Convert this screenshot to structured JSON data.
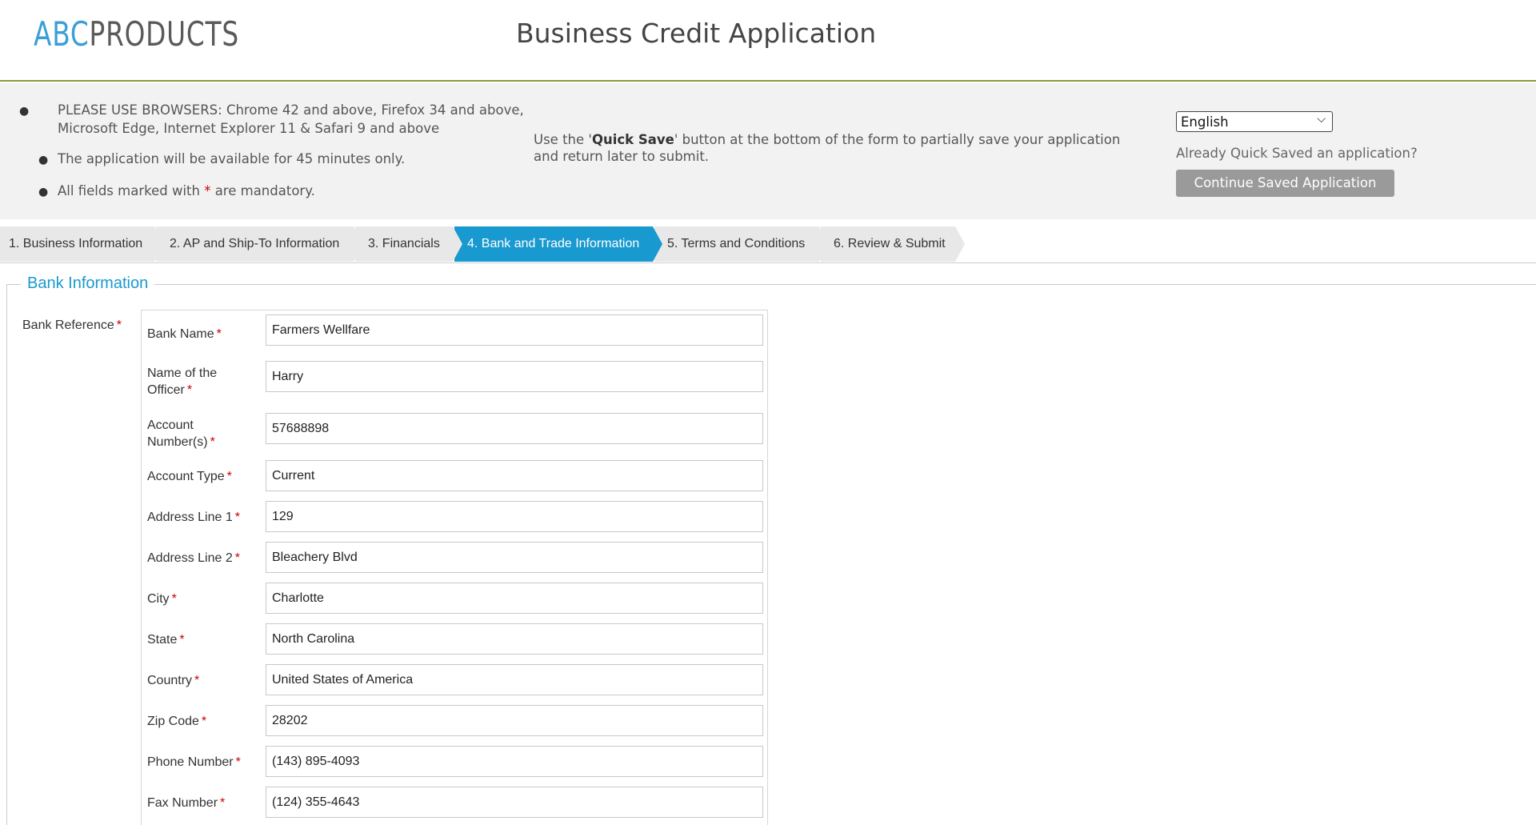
{
  "header": {
    "logo_abc": "ABC",
    "logo_products": "PRODUCTS",
    "title": "Business Credit Application"
  },
  "notice": {
    "items": [
      {
        "text": "PLEASE USE BROWSERS: Chrome 42 and above, Firefox 34 and above, Microsoft Edge, Internet Explorer 11 & Safari 9 and above"
      },
      {
        "text": "The application will be available for 45 minutes only."
      },
      {
        "text_before": "All fields marked with ",
        "asterisk": "*",
        "text_after": " are mandatory."
      }
    ],
    "quick_save_before": "Use the '",
    "quick_save_bold": "Quick Save",
    "quick_save_after": "' button at the bottom of the form to partially save your application and return later to submit.",
    "language": "English",
    "already_saved": "Already Quick Saved an application?",
    "continue_button": "Continue Saved Application"
  },
  "steps": [
    {
      "label": "1. Business Information",
      "active": false
    },
    {
      "label": "2. AP and Ship-To Information",
      "active": false
    },
    {
      "label": "3. Financials",
      "active": false
    },
    {
      "label": "4. Bank and Trade Information",
      "active": true
    },
    {
      "label": "5. Terms and Conditions",
      "active": false
    },
    {
      "label": "6. Review & Submit",
      "active": false
    }
  ],
  "section": {
    "legend": "Bank Information",
    "bank_reference_label": "Bank Reference",
    "required_mark": "*"
  },
  "fields": [
    {
      "label": "Bank Name",
      "value": "Farmers Wellfare"
    },
    {
      "label": "Name of the Officer",
      "value": "Harry"
    },
    {
      "label": "Account Number(s)",
      "value": "57688898"
    },
    {
      "label": "Account Type",
      "value": "Current"
    },
    {
      "label": "Address Line 1",
      "value": "129"
    },
    {
      "label": "Address Line 2",
      "value": "Bleachery Blvd"
    },
    {
      "label": "City",
      "value": "Charlotte"
    },
    {
      "label": "State",
      "value": "North Carolina"
    },
    {
      "label": "Country",
      "value": "United States of America"
    },
    {
      "label": "Zip Code",
      "value": "28202"
    },
    {
      "label": "Phone Number",
      "value": "(143) 895-4093"
    },
    {
      "label": "Fax Number",
      "value": "(124) 355-4643"
    }
  ],
  "colors": {
    "accent": "#1899cf",
    "required": "#cc0000",
    "header_rule": "#8a9a3b"
  }
}
